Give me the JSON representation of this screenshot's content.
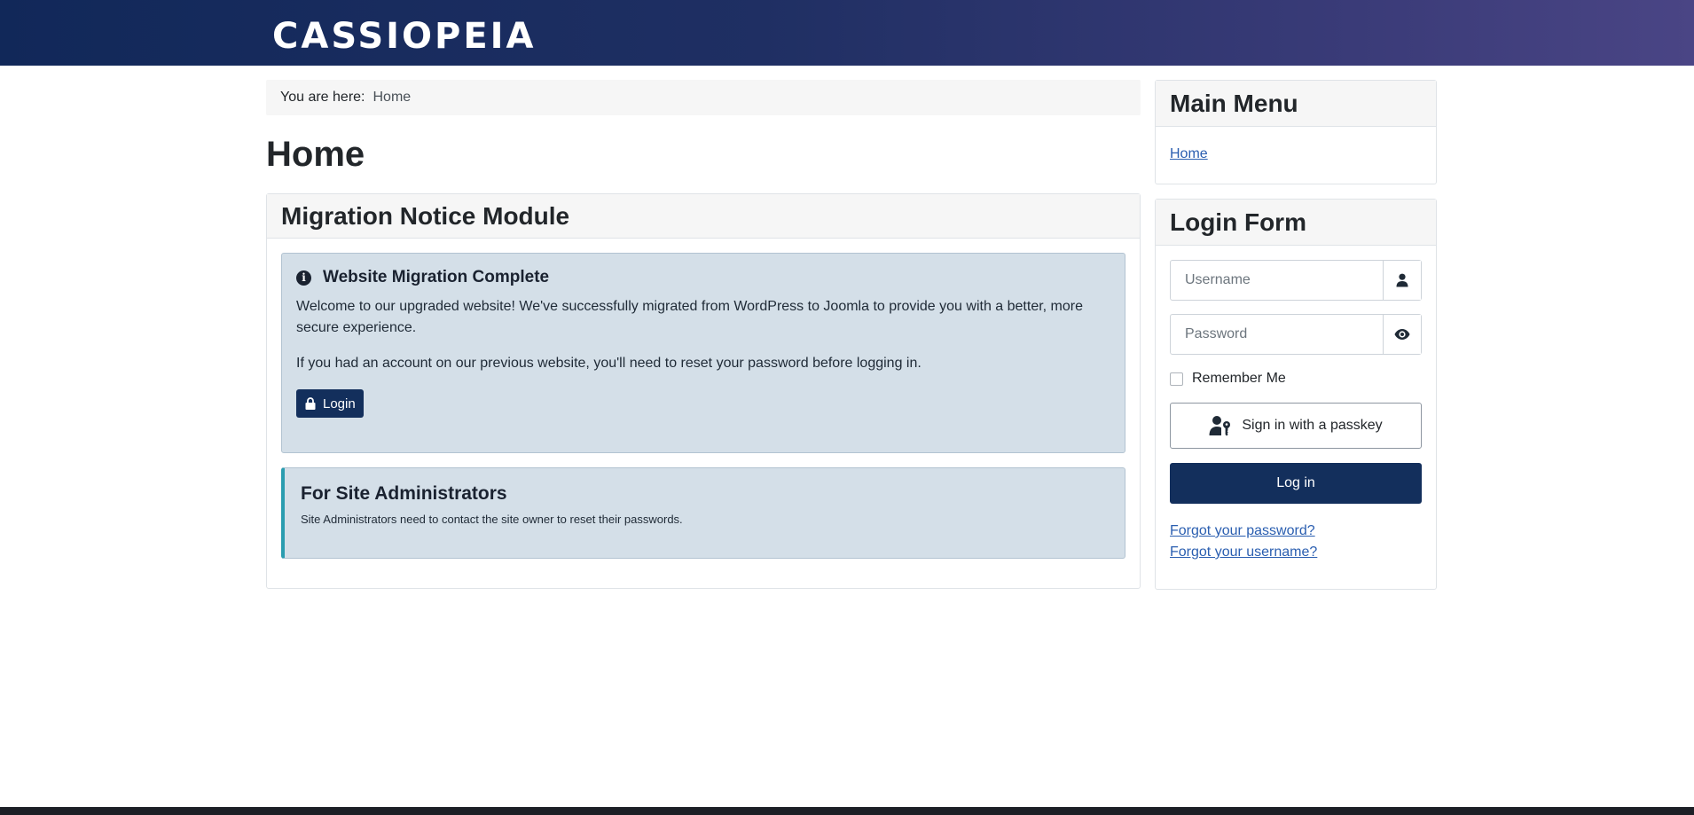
{
  "header": {
    "brand": "CASSIOPEIA"
  },
  "breadcrumb": {
    "label": "You are here:",
    "current": "Home"
  },
  "page": {
    "title": "Home"
  },
  "migration_module": {
    "title": "Migration Notice Module",
    "alert": {
      "icon": "info-icon",
      "title": "Website Migration Complete",
      "text1": "Welcome to our upgraded website! We've successfully migrated from WordPress to Joomla to provide you with a better, more secure experience.",
      "text2": "If you had an account on our previous website, you'll need to reset your password before logging in.",
      "button_label": "Login"
    },
    "admin_box": {
      "title": "For Site Administrators",
      "text": "Site Administrators need to contact the site owner to reset their passwords."
    }
  },
  "main_menu": {
    "title": "Main Menu",
    "items": [
      {
        "label": "Home"
      }
    ]
  },
  "login_form": {
    "title": "Login Form",
    "username_placeholder": "Username",
    "password_placeholder": "Password",
    "remember_label": "Remember Me",
    "passkey_label": "Sign in with a passkey",
    "submit_label": "Log in",
    "forgot_password": "Forgot your password?",
    "forgot_username": "Forgot your username?"
  },
  "colors": {
    "header_start": "#112859",
    "header_end": "#4a4585",
    "primary": "#132f5c",
    "alert_bg": "#d4dfe8",
    "accent_border": "#2a9db0",
    "link": "#2a5eb0"
  }
}
